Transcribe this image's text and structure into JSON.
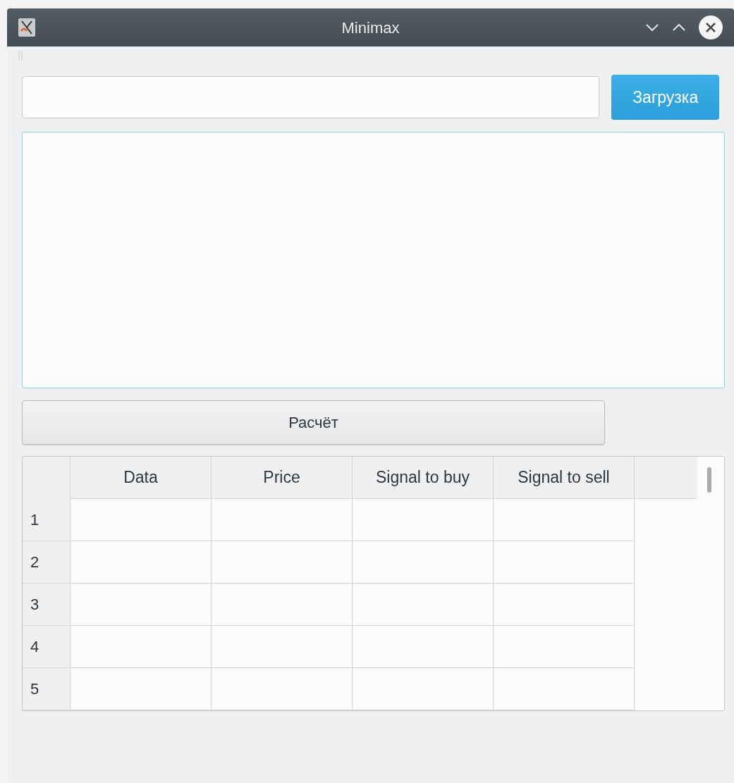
{
  "window": {
    "title": "Minimax"
  },
  "load_button": {
    "label": "Загрузка"
  },
  "calculate_button": {
    "label": "Расчёт"
  },
  "table": {
    "columns": [
      "Data",
      "Price",
      "Signal to buy",
      "Signal to sell"
    ],
    "rows": [
      {
        "header": "1"
      },
      {
        "header": "2"
      },
      {
        "header": "3"
      },
      {
        "header": "4"
      },
      {
        "header": "5"
      }
    ]
  }
}
